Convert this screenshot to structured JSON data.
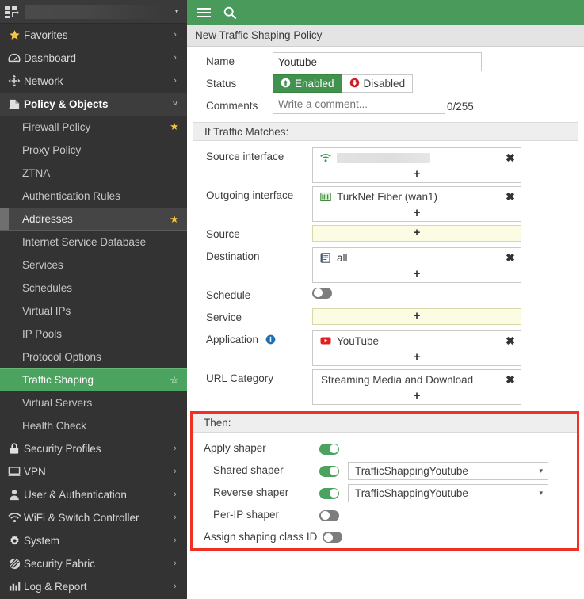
{
  "device": {
    "name_redacted": true,
    "chevron": "▾"
  },
  "topbar": {
    "menu_icon": "hamburger-icon",
    "search_icon": "search-icon"
  },
  "breadcrumb": {
    "title": "New Traffic Shaping Policy"
  },
  "sidebar": {
    "items": [
      {
        "label": "Favorites",
        "icon": "star-icon",
        "level": 0,
        "chevron": "›",
        "state": "normal"
      },
      {
        "label": "Dashboard",
        "icon": "dashboard-icon",
        "level": 0,
        "chevron": "›",
        "state": "normal"
      },
      {
        "label": "Network",
        "icon": "network-icon",
        "level": 0,
        "chevron": "›",
        "state": "normal"
      },
      {
        "label": "Policy & Objects",
        "icon": "policy-icon",
        "level": 0,
        "chevron": "˅",
        "state": "expanded"
      },
      {
        "label": "Firewall Policy",
        "icon": "",
        "level": 1,
        "star": "filled",
        "state": "normal"
      },
      {
        "label": "Proxy Policy",
        "icon": "",
        "level": 1,
        "state": "normal"
      },
      {
        "label": "ZTNA",
        "icon": "",
        "level": 1,
        "state": "normal"
      },
      {
        "label": "Authentication Rules",
        "icon": "",
        "level": 1,
        "state": "normal"
      },
      {
        "label": "Addresses",
        "icon": "",
        "level": 1,
        "star": "filled",
        "state": "hovered"
      },
      {
        "label": "Internet Service Database",
        "icon": "",
        "level": 1,
        "state": "normal"
      },
      {
        "label": "Services",
        "icon": "",
        "level": 1,
        "state": "normal"
      },
      {
        "label": "Schedules",
        "icon": "",
        "level": 1,
        "state": "normal"
      },
      {
        "label": "Virtual IPs",
        "icon": "",
        "level": 1,
        "state": "normal"
      },
      {
        "label": "IP Pools",
        "icon": "",
        "level": 1,
        "state": "normal"
      },
      {
        "label": "Protocol Options",
        "icon": "",
        "level": 1,
        "state": "normal"
      },
      {
        "label": "Traffic Shaping",
        "icon": "",
        "level": 1,
        "star": "hollow",
        "state": "active"
      },
      {
        "label": "Virtual Servers",
        "icon": "",
        "level": 1,
        "state": "normal"
      },
      {
        "label": "Health Check",
        "icon": "",
        "level": 1,
        "state": "normal"
      },
      {
        "label": "Security Profiles",
        "icon": "lock-icon",
        "level": 0,
        "chevron": "›",
        "state": "normal"
      },
      {
        "label": "VPN",
        "icon": "vpn-icon",
        "level": 0,
        "chevron": "›",
        "state": "normal"
      },
      {
        "label": "User & Authentication",
        "icon": "user-icon",
        "level": 0,
        "chevron": "›",
        "state": "normal"
      },
      {
        "label": "WiFi & Switch Controller",
        "icon": "wifi-icon",
        "level": 0,
        "chevron": "›",
        "state": "normal"
      },
      {
        "label": "System",
        "icon": "gear-icon",
        "level": 0,
        "chevron": "›",
        "state": "normal"
      },
      {
        "label": "Security Fabric",
        "icon": "fabric-icon",
        "level": 0,
        "chevron": "›",
        "state": "normal"
      },
      {
        "label": "Log & Report",
        "icon": "chart-icon",
        "level": 0,
        "chevron": "›",
        "state": "normal"
      }
    ]
  },
  "form": {
    "name": {
      "label": "Name",
      "value": "Youtube"
    },
    "status": {
      "label": "Status",
      "options": [
        {
          "label": "Enabled",
          "selected": true,
          "icon": "arrow-up-circle-icon"
        },
        {
          "label": "Disabled",
          "selected": false,
          "icon": "arrow-down-circle-icon"
        }
      ]
    },
    "comments": {
      "label": "Comments",
      "placeholder": "Write a comment...",
      "value": "",
      "counter": "0/255"
    }
  },
  "match_section": {
    "title": "If Traffic Matches:",
    "rows": [
      {
        "label": "Source interface",
        "required": false,
        "values": [
          {
            "text": "",
            "redacted": true,
            "icon": "wifi-icon"
          }
        ],
        "add": "+"
      },
      {
        "label": "Outgoing interface",
        "required": false,
        "values": [
          {
            "text": "TurkNet Fiber (wan1)",
            "icon": "interface-icon"
          }
        ],
        "add": "+"
      },
      {
        "label": "Source",
        "required": true,
        "values": [],
        "add": "+"
      },
      {
        "label": "Destination",
        "required": false,
        "values": [
          {
            "text": "all",
            "icon": "address-icon"
          }
        ],
        "add": "+"
      }
    ],
    "schedule": {
      "label": "Schedule",
      "enabled": false
    },
    "service": {
      "label": "Service",
      "required": true,
      "values": [],
      "add": "+"
    },
    "application": {
      "label": "Application",
      "info_icon": "info-icon",
      "values": [
        {
          "text": "YouTube",
          "icon": "youtube-icon"
        }
      ],
      "add": "+"
    },
    "url_category": {
      "label": "URL Category",
      "values": [
        {
          "text": "Streaming Media and Download",
          "icon": ""
        }
      ],
      "add": "+"
    },
    "remove_icon": "✖"
  },
  "then_section": {
    "title": "Then:",
    "highlight_color": "#ee3124",
    "rows": [
      {
        "label": "Apply shaper",
        "indent": 0,
        "toggle": true,
        "dropdown": null
      },
      {
        "label": "Shared shaper",
        "indent": 1,
        "toggle": true,
        "dropdown": "TrafficShappingYoutube"
      },
      {
        "label": "Reverse shaper",
        "indent": 1,
        "toggle": true,
        "dropdown": "TrafficShappingYoutube"
      },
      {
        "label": "Per-IP shaper",
        "indent": 1,
        "toggle": false,
        "dropdown": null
      },
      {
        "label": "Assign shaping class ID",
        "indent": 0,
        "inline": true,
        "toggle": false,
        "dropdown": null
      }
    ],
    "caret": "▾"
  },
  "colors": {
    "brand_green": "#4a9a5c",
    "active_green": "#4ca25f",
    "toggle_on": "#4ca25f",
    "toggle_off": "#7d7d7d",
    "highlight_red": "#ee3124",
    "required_bg": "#fcfce4",
    "star_gold": "#f5c443",
    "sidebar_bg": "#333333"
  }
}
